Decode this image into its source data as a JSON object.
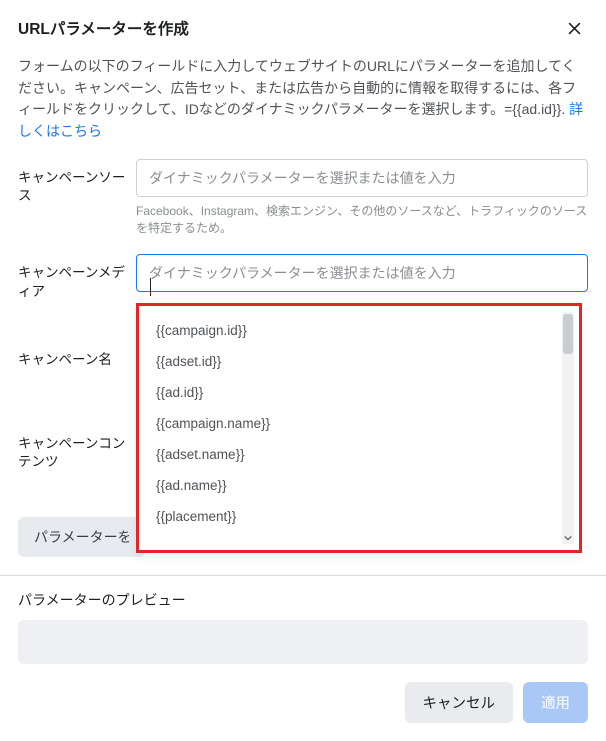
{
  "header": {
    "title": "URLパラメーターを作成"
  },
  "description": {
    "text_a": "フォームの以下のフィールドに入力してウェブサイトのURLにパラメーターを追加してください。キャンペーン、広告セット、または広告から自動的に情報を取得するには、各フィールドをクリックして、IDなどのダイナミックパラメーターを選択します。={{ad.id}}. ",
    "link": "詳しくはこちら"
  },
  "fields": {
    "source": {
      "label": "キャンペーンソース",
      "placeholder": "ダイナミックパラメーターを選択または値を入力",
      "helper": "Facebook、Instagram、検索エンジン、その他のソースなど、トラフィックのソースを特定するため。"
    },
    "medium": {
      "label": "キャンペーンメディア",
      "placeholder": "ダイナミックパラメーターを選択または値を入力",
      "value": ""
    },
    "name": {
      "label": "キャンペーン名"
    },
    "content": {
      "label": "キャンペーンコンテンツ"
    }
  },
  "dropdown": {
    "items": [
      "{{campaign.id}}",
      "{{adset.id}}",
      "{{ad.id}}",
      "{{campaign.name}}",
      "{{adset.name}}",
      "{{ad.name}}",
      "{{placement}}"
    ]
  },
  "param_button": {
    "label": "パラメーターを追加"
  },
  "preview": {
    "title": "パラメーターのプレビュー"
  },
  "footer": {
    "cancel": "キャンセル",
    "apply": "適用"
  }
}
